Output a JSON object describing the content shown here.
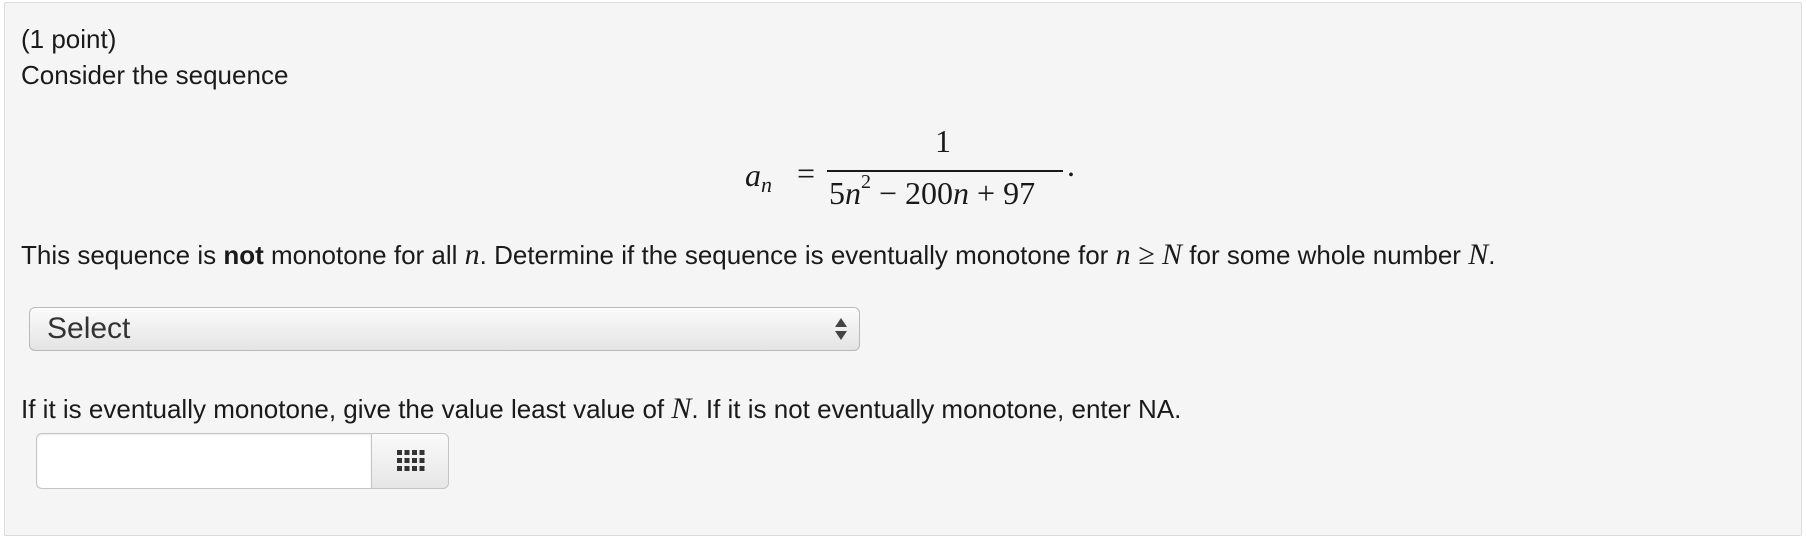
{
  "problem": {
    "points": "(1 point)",
    "intro": "Consider the sequence",
    "formula": {
      "lhs_var": "a",
      "lhs_sub": "n",
      "equals": "=",
      "numerator": "1",
      "den_term1_coef": "5",
      "den_term1_var": "n",
      "den_term1_exp": "2",
      "den_op1": " − ",
      "den_term2_coef": "200",
      "den_term2_var": "n",
      "den_op2": " + ",
      "den_term3": "97",
      "period": "."
    },
    "statement": {
      "part1": "This sequence is ",
      "bold": "not",
      "part2": " monotone for all ",
      "var_n": "n",
      "part3": ". Determine if the sequence is eventually monotone for ",
      "ineq": "n ≥ N",
      "part4": " for some whole number ",
      "var_N": "N",
      "part5": "."
    },
    "select": {
      "selected": "Select"
    },
    "question2": {
      "part1": "If it is eventually monotone, give the value least value of ",
      "var_N": "N",
      "part2": ". If it is not eventually monotone, enter NA."
    },
    "answer": {
      "value": "",
      "placeholder": ""
    },
    "icons": {
      "select_arrows": "updown-arrows-icon",
      "grid_button": "keypad-grid-icon"
    },
    "colors": {
      "panel_bg": "#f5f5f5",
      "border": "#dcdcdc",
      "text": "#1a1a1a"
    }
  }
}
